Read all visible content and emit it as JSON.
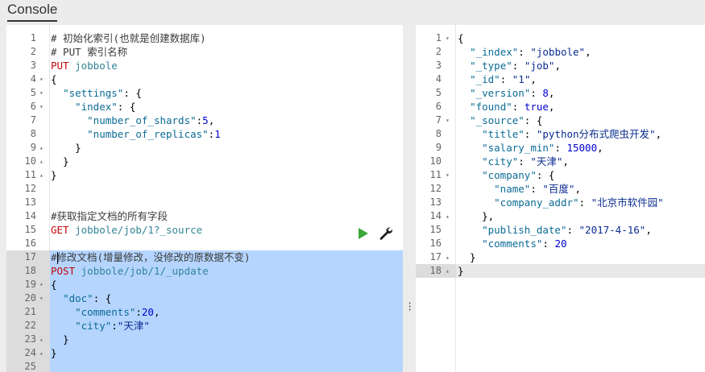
{
  "app": {
    "tab_console": "Console"
  },
  "colors": {
    "selection": "#b5d5ff",
    "method": "#c5060b",
    "url": "#318495",
    "play": "#3aa83a"
  },
  "request_editor": {
    "lines": [
      {
        "n": "1",
        "fold": "",
        "parts": [
          [
            "c-comment",
            "# 初始化索引(也就是创建数据库)"
          ]
        ]
      },
      {
        "n": "2",
        "fold": "",
        "parts": [
          [
            "c-comment",
            "# PUT 索引名称"
          ]
        ]
      },
      {
        "n": "3",
        "fold": "",
        "parts": [
          [
            "c-method",
            "PUT"
          ],
          [
            "c-pun",
            " "
          ],
          [
            "c-url",
            "jobbole"
          ]
        ]
      },
      {
        "n": "4",
        "fold": "▾",
        "parts": [
          [
            "c-pun",
            "{"
          ]
        ]
      },
      {
        "n": "5",
        "fold": "▾",
        "parts": [
          [
            "c-pun",
            "  "
          ],
          [
            "c-key",
            "\"settings\""
          ],
          [
            "c-pun",
            ": {"
          ]
        ]
      },
      {
        "n": "6",
        "fold": "▾",
        "parts": [
          [
            "c-pun",
            "    "
          ],
          [
            "c-key",
            "\"index\""
          ],
          [
            "c-pun",
            ": {"
          ]
        ]
      },
      {
        "n": "7",
        "fold": "",
        "parts": [
          [
            "c-pun",
            "      "
          ],
          [
            "c-key",
            "\"number_of_shards\""
          ],
          [
            "c-pun",
            ":"
          ],
          [
            "c-num",
            "5"
          ],
          [
            "c-pun",
            ","
          ]
        ]
      },
      {
        "n": "8",
        "fold": "",
        "parts": [
          [
            "c-pun",
            "      "
          ],
          [
            "c-key",
            "\"number_of_replicas\""
          ],
          [
            "c-pun",
            ":"
          ],
          [
            "c-num",
            "1"
          ]
        ]
      },
      {
        "n": "9",
        "fold": "▴",
        "parts": [
          [
            "c-pun",
            "    }"
          ]
        ]
      },
      {
        "n": "10",
        "fold": "▴",
        "parts": [
          [
            "c-pun",
            "  }"
          ]
        ]
      },
      {
        "n": "11",
        "fold": "▴",
        "parts": [
          [
            "c-pun",
            "}"
          ]
        ]
      },
      {
        "n": "12",
        "fold": "",
        "parts": []
      },
      {
        "n": "13",
        "fold": "",
        "parts": []
      },
      {
        "n": "14",
        "fold": "",
        "parts": [
          [
            "c-comment",
            "#获取指定文档的所有字段"
          ]
        ]
      },
      {
        "n": "15",
        "fold": "",
        "parts": [
          [
            "c-method",
            "GET"
          ],
          [
            "c-pun",
            " "
          ],
          [
            "c-url",
            "jobbole/job/1?_source"
          ]
        ]
      },
      {
        "n": "16",
        "fold": "",
        "parts": []
      },
      {
        "n": "17",
        "fold": "",
        "parts": [
          [
            "c-comment",
            "#修改文档(增量修改，没修改的原数据不变)"
          ]
        ]
      },
      {
        "n": "18",
        "fold": "",
        "parts": [
          [
            "c-method",
            "POST"
          ],
          [
            "c-pun",
            " "
          ],
          [
            "c-url",
            "jobbole/job/1/_update"
          ]
        ]
      },
      {
        "n": "19",
        "fold": "▾",
        "parts": [
          [
            "c-pun",
            "{"
          ]
        ]
      },
      {
        "n": "20",
        "fold": "▾",
        "parts": [
          [
            "c-pun",
            "  "
          ],
          [
            "c-key",
            "\"doc\""
          ],
          [
            "c-pun",
            ": {"
          ]
        ]
      },
      {
        "n": "21",
        "fold": "",
        "parts": [
          [
            "c-pun",
            "    "
          ],
          [
            "c-key",
            "\"comments\""
          ],
          [
            "c-pun",
            ":"
          ],
          [
            "c-num",
            "20"
          ],
          [
            "c-pun",
            ","
          ]
        ]
      },
      {
        "n": "22",
        "fold": "",
        "parts": [
          [
            "c-pun",
            "    "
          ],
          [
            "c-key",
            "\"city\""
          ],
          [
            "c-pun",
            ":"
          ],
          [
            "c-str",
            "\"天津\""
          ]
        ]
      },
      {
        "n": "23",
        "fold": "▴",
        "parts": [
          [
            "c-pun",
            "  }"
          ]
        ]
      },
      {
        "n": "24",
        "fold": "▴",
        "parts": [
          [
            "c-pun",
            "}"
          ]
        ]
      },
      {
        "n": "25",
        "fold": "",
        "parts": []
      }
    ]
  },
  "response_viewer": {
    "lines": [
      {
        "n": "1",
        "fold": "▾",
        "parts": [
          [
            "c-pun",
            "{"
          ]
        ]
      },
      {
        "n": "2",
        "fold": "",
        "parts": [
          [
            "c-pun",
            "  "
          ],
          [
            "c-key",
            "\"_index\""
          ],
          [
            "c-pun",
            ": "
          ],
          [
            "c-str",
            "\"jobbole\""
          ],
          [
            "c-pun",
            ","
          ]
        ]
      },
      {
        "n": "3",
        "fold": "",
        "parts": [
          [
            "c-pun",
            "  "
          ],
          [
            "c-key",
            "\"_type\""
          ],
          [
            "c-pun",
            ": "
          ],
          [
            "c-str",
            "\"job\""
          ],
          [
            "c-pun",
            ","
          ]
        ]
      },
      {
        "n": "4",
        "fold": "",
        "parts": [
          [
            "c-pun",
            "  "
          ],
          [
            "c-key",
            "\"_id\""
          ],
          [
            "c-pun",
            ": "
          ],
          [
            "c-str",
            "\"1\""
          ],
          [
            "c-pun",
            ","
          ]
        ]
      },
      {
        "n": "5",
        "fold": "",
        "parts": [
          [
            "c-pun",
            "  "
          ],
          [
            "c-key",
            "\"_version\""
          ],
          [
            "c-pun",
            ": "
          ],
          [
            "c-num",
            "8"
          ],
          [
            "c-pun",
            ","
          ]
        ]
      },
      {
        "n": "6",
        "fold": "",
        "parts": [
          [
            "c-pun",
            "  "
          ],
          [
            "c-key",
            "\"found\""
          ],
          [
            "c-pun",
            ": "
          ],
          [
            "c-bool",
            "true"
          ],
          [
            "c-pun",
            ","
          ]
        ]
      },
      {
        "n": "7",
        "fold": "▾",
        "parts": [
          [
            "c-pun",
            "  "
          ],
          [
            "c-key",
            "\"_source\""
          ],
          [
            "c-pun",
            ": {"
          ]
        ]
      },
      {
        "n": "8",
        "fold": "",
        "parts": [
          [
            "c-pun",
            "    "
          ],
          [
            "c-key",
            "\"title\""
          ],
          [
            "c-pun",
            ": "
          ],
          [
            "c-str",
            "\"python分布式爬虫开发\""
          ],
          [
            "c-pun",
            ","
          ]
        ]
      },
      {
        "n": "9",
        "fold": "",
        "parts": [
          [
            "c-pun",
            "    "
          ],
          [
            "c-key",
            "\"salary_min\""
          ],
          [
            "c-pun",
            ": "
          ],
          [
            "c-num",
            "15000"
          ],
          [
            "c-pun",
            ","
          ]
        ]
      },
      {
        "n": "10",
        "fold": "",
        "parts": [
          [
            "c-pun",
            "    "
          ],
          [
            "c-key",
            "\"city\""
          ],
          [
            "c-pun",
            ": "
          ],
          [
            "c-str",
            "\"天津\""
          ],
          [
            "c-pun",
            ","
          ]
        ]
      },
      {
        "n": "11",
        "fold": "▾",
        "parts": [
          [
            "c-pun",
            "    "
          ],
          [
            "c-key",
            "\"company\""
          ],
          [
            "c-pun",
            ": {"
          ]
        ]
      },
      {
        "n": "12",
        "fold": "",
        "parts": [
          [
            "c-pun",
            "      "
          ],
          [
            "c-key",
            "\"name\""
          ],
          [
            "c-pun",
            ": "
          ],
          [
            "c-str",
            "\"百度\""
          ],
          [
            "c-pun",
            ","
          ]
        ]
      },
      {
        "n": "13",
        "fold": "",
        "parts": [
          [
            "c-pun",
            "      "
          ],
          [
            "c-key",
            "\"company_addr\""
          ],
          [
            "c-pun",
            ": "
          ],
          [
            "c-str",
            "\"北京市软件园\""
          ]
        ]
      },
      {
        "n": "14",
        "fold": "▴",
        "parts": [
          [
            "c-pun",
            "    },"
          ]
        ]
      },
      {
        "n": "15",
        "fold": "",
        "parts": [
          [
            "c-pun",
            "    "
          ],
          [
            "c-key",
            "\"publish_date\""
          ],
          [
            "c-pun",
            ": "
          ],
          [
            "c-str",
            "\"2017-4-16\""
          ],
          [
            "c-pun",
            ","
          ]
        ]
      },
      {
        "n": "16",
        "fold": "",
        "parts": [
          [
            "c-pun",
            "    "
          ],
          [
            "c-key",
            "\"comments\""
          ],
          [
            "c-pun",
            ": "
          ],
          [
            "c-num",
            "20"
          ]
        ]
      },
      {
        "n": "17",
        "fold": "▴",
        "parts": [
          [
            "c-pun",
            "  }"
          ]
        ]
      },
      {
        "n": "18",
        "fold": "▴",
        "parts": [
          [
            "c-pun",
            "}"
          ]
        ]
      }
    ]
  },
  "icons": {
    "run": "play-icon",
    "settings": "wrench-icon",
    "splitter": "vertical-dots-icon"
  }
}
